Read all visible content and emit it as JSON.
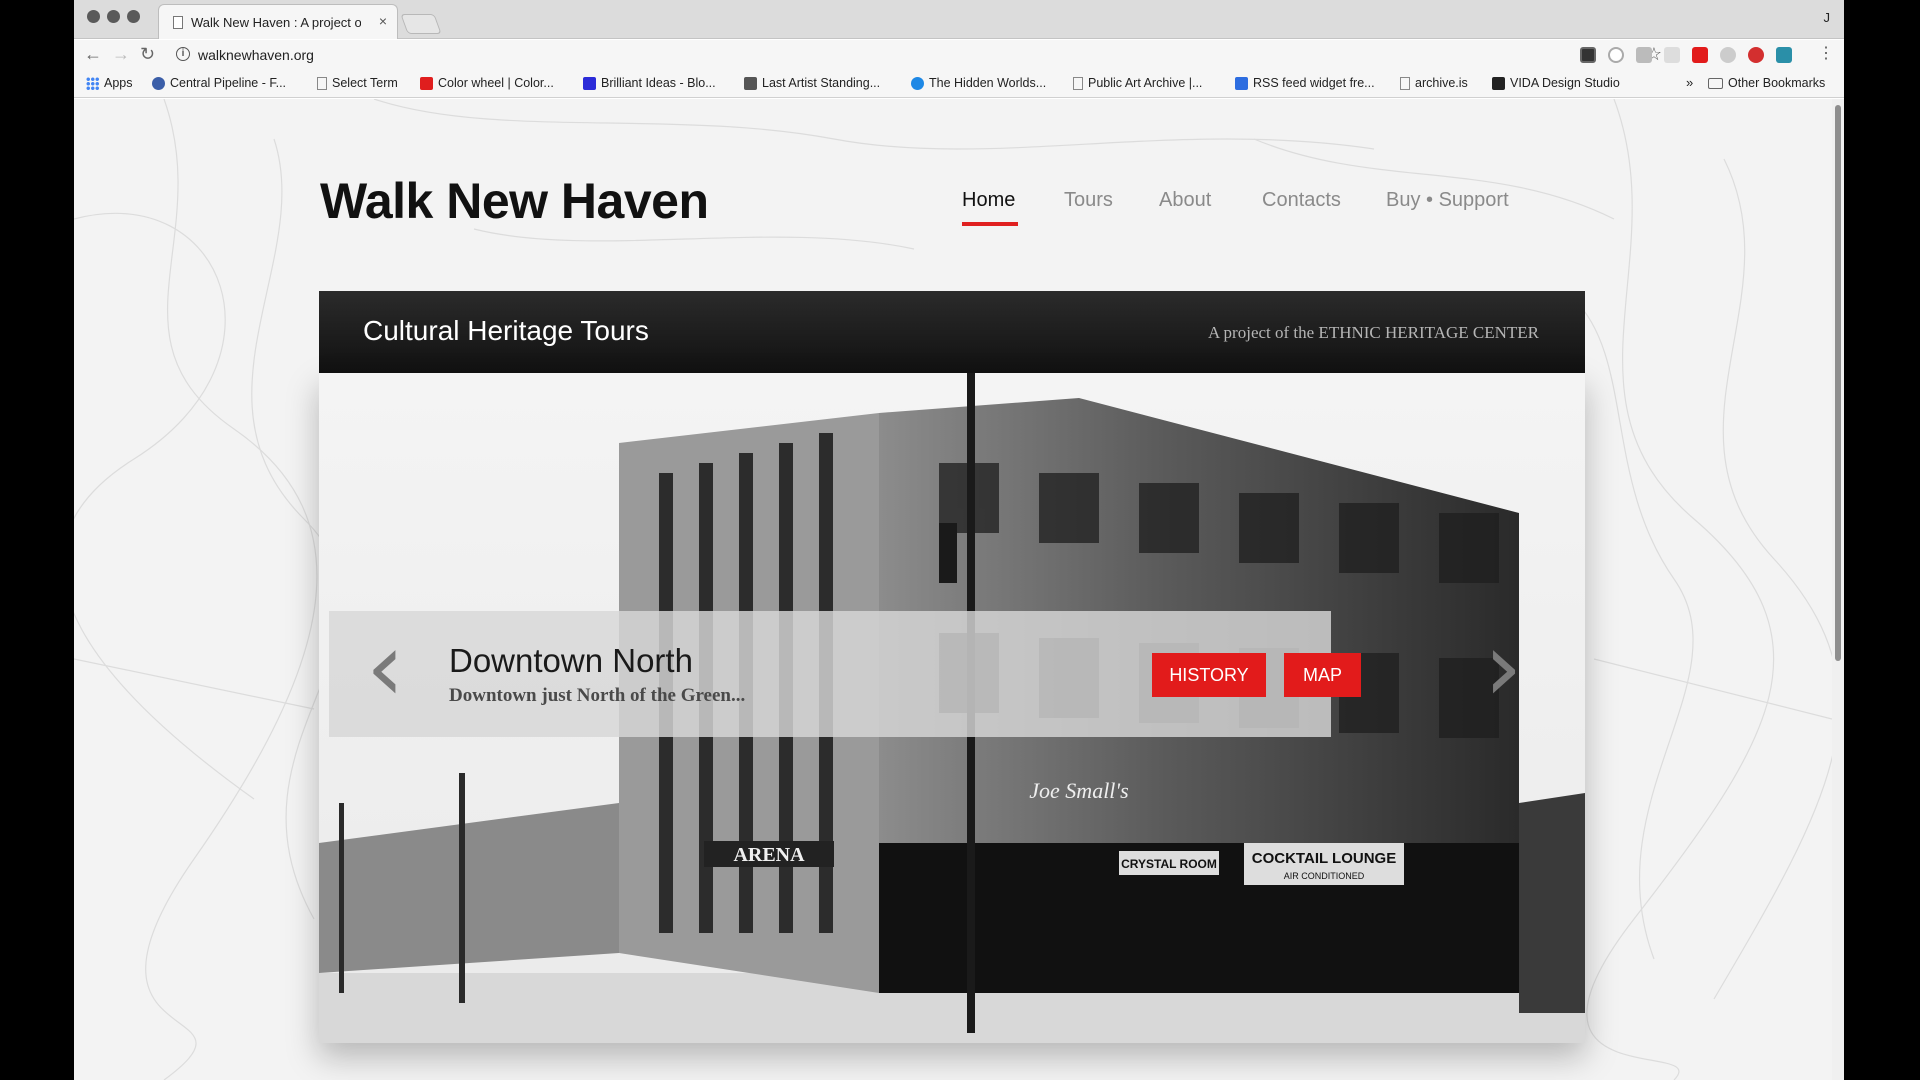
{
  "browser": {
    "tab_title": "Walk New Haven : A project of",
    "tab_close": "×",
    "profile": "J",
    "url": "walknewhaven.org",
    "bookmarks": [
      {
        "label": "Apps",
        "icon": "apps-grid-icon",
        "color": "#4285f4"
      },
      {
        "label": "Central Pipeline - F...",
        "icon": "globe-icon",
        "color": "#3b5ea8"
      },
      {
        "label": "Select Term",
        "icon": "page-icon",
        "color": "#888888"
      },
      {
        "label": "Color wheel | Color...",
        "icon": "adobe-icon",
        "color": "#e01e1e"
      },
      {
        "label": "Brilliant Ideas - Blo...",
        "icon": "b-logo-icon",
        "color": "#2b2bd8"
      },
      {
        "label": "Last Artist Standing...",
        "icon": "leaf-icon",
        "color": "#555555"
      },
      {
        "label": "The Hidden Worlds...",
        "icon": "circle-logo-icon",
        "color": "#1e88e5"
      },
      {
        "label": "Public Art Archive |...",
        "icon": "page-icon",
        "color": "#888888"
      },
      {
        "label": "RSS feed widget fre...",
        "icon": "puzzle-icon",
        "color": "#2d6de0"
      },
      {
        "label": "archive.is",
        "icon": "page-icon",
        "color": "#888888"
      },
      {
        "label": "VIDA Design Studio",
        "icon": "v-logo-icon",
        "color": "#222222"
      }
    ],
    "bookmarks_overflow": "»",
    "other_bookmarks": "Other Bookmarks"
  },
  "site": {
    "brand": "Walk New Haven",
    "nav": [
      "Home",
      "Tours",
      "About",
      "Contacts",
      "Buy • Support"
    ],
    "banner_title": "Cultural Heritage Tours",
    "banner_sub": "A project of the ETHNIC HERITAGE CENTER",
    "slide_title": "Downtown North",
    "slide_sub": "Downtown just North of the Green...",
    "history_btn": "HISTORY",
    "map_btn": "MAP",
    "accent": "#e21b1b",
    "photo_signs": [
      "ARENA",
      "Joe Small's",
      "CRYSTAL ROOM",
      "COCKTAIL LOUNGE",
      "AIR CONDITIONED"
    ]
  }
}
